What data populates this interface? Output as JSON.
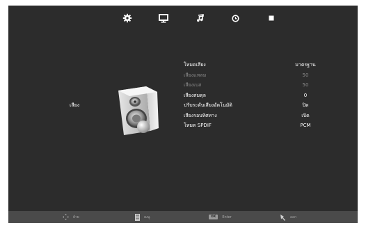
{
  "top_tabs": [
    {
      "icon": "gear-icon"
    },
    {
      "icon": "monitor-icon"
    },
    {
      "icon": "music-note-icon"
    },
    {
      "icon": "clock-icon"
    },
    {
      "icon": "square-icon"
    }
  ],
  "category": {
    "label": "เสียง"
  },
  "sound_menu": {
    "items": [
      {
        "label": "โหมดเสียง",
        "value": "มาตรฐาน",
        "enabled": true
      },
      {
        "label": "เสียงแหลม",
        "value": "50",
        "enabled": false
      },
      {
        "label": "เสียงเบส",
        "value": "50",
        "enabled": false
      },
      {
        "label": "เสียงสมดุล",
        "value": "0",
        "enabled": true
      },
      {
        "label": "ปรับระดับเสียงอัตโนมัติ",
        "value": "ปิด",
        "enabled": true
      },
      {
        "label": "เสียงรอบทิศทาง",
        "value": "เปิด",
        "enabled": true
      },
      {
        "label": "โหมด SPDIF",
        "value": "PCM",
        "enabled": true
      }
    ]
  },
  "bottom_hints": {
    "move": {
      "icon": "dpad-icon",
      "label": "ย้าย"
    },
    "menu": {
      "icon": "menu-icon",
      "label": "เมนู"
    },
    "enter": {
      "badge": "OK",
      "label": "Enter"
    },
    "exit": {
      "icon": "exit-icon",
      "label": "ออก"
    }
  },
  "colors": {
    "background": "#2c2c2c",
    "text": "#ffffff",
    "disabled_text": "#8a8a8a",
    "bottom_bar": "#4a4a4a"
  }
}
